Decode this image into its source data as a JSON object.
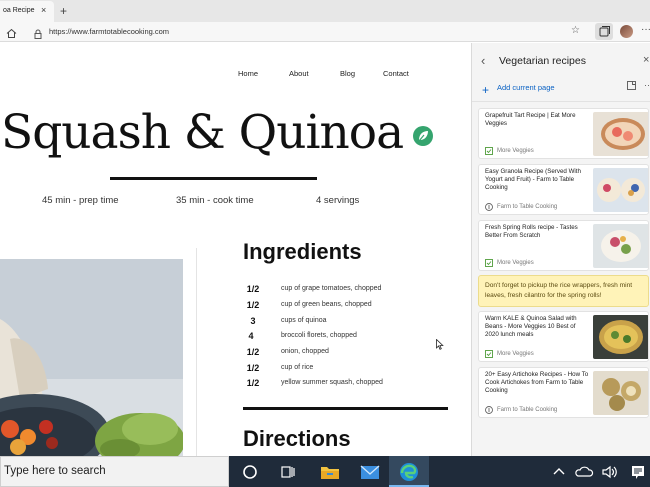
{
  "browser": {
    "tab_title": "oa Recipe",
    "tab_close": "×",
    "new_tab": "+",
    "url": "https://www.farmtotablecooking.com",
    "star_icon": "☆",
    "menu": "···"
  },
  "page": {
    "nav": [
      "Home",
      "About",
      "Blog",
      "Contact"
    ],
    "headline": "Squash & Quinoa",
    "meta": {
      "prep": "45 min - prep time",
      "cook": "35 min - cook time",
      "servings": "4 servings"
    },
    "ingredients_heading": "Ingredients",
    "ingredients": [
      {
        "qty": "1/2",
        "item": "cup of grape tomatoes, chopped"
      },
      {
        "qty": "1/2",
        "item": "cup of green beans, chopped"
      },
      {
        "qty": "3",
        "item": "cups of quinoa"
      },
      {
        "qty": "4",
        "item": "broccoli florets, chopped"
      },
      {
        "qty": "1/2",
        "item": "onion, chopped"
      },
      {
        "qty": "1/2",
        "item": "cup of rice"
      },
      {
        "qty": "1/2",
        "item": "yellow summer squash, chopped"
      }
    ],
    "directions_heading": "Directions"
  },
  "collections": {
    "back": "‹",
    "title": "Vegetarian recipes",
    "close": "×",
    "add_plus": "+",
    "add_label": "Add current page",
    "more": "···",
    "cards": [
      {
        "title": "Grapefruit Tart Recipe | Eat More Veggies",
        "source": "More Veggies"
      },
      {
        "title": "Easy Granola Recipe (Served With Yogurt and Fruit) - Farm to Table Cooking",
        "source": "Farm to Table Cooking"
      },
      {
        "title": "Fresh Spring Rolls recipe - Tastes Better From Scratch",
        "source": "More Veggies"
      },
      {
        "title": "Warm KALE & Quinoa Salad with Beans - More Veggies 10 Best of 2020 lunch meals",
        "source": "More Veggies"
      },
      {
        "title": "20+ Easy Artichoke Recipes - How To Cook Artichokes from Farm to Table Cooking",
        "source": "Farm to Table Cooking"
      }
    ],
    "note": "Don't forget to pickup the rice wrappers, fresh mint leaves, fresh cilantro for the spring rolls!"
  },
  "taskbar": {
    "search_text": "Type here to search"
  },
  "colors": {
    "accent": "#0b62c4",
    "leaf_badge": "#35a46e",
    "note_bg": "#fff3b8",
    "taskbar": "#1f2b3a"
  }
}
